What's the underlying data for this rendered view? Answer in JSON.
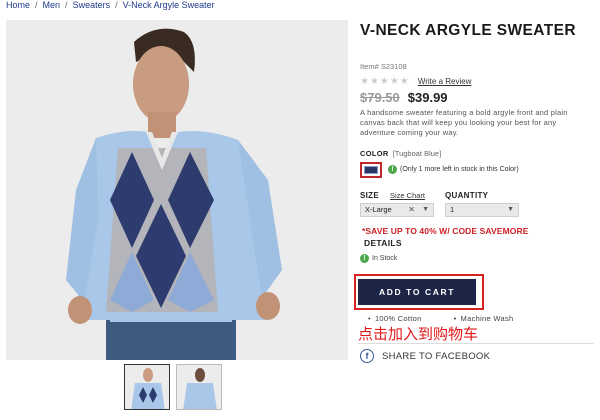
{
  "breadcrumb": [
    "Home",
    "Men",
    "Sweaters",
    "V-Neck Argyle Sweater"
  ],
  "breadcrumb_separator": "/",
  "product": {
    "title": "V-NECK ARGYLE SWEATER",
    "item_number": "Item# S23108",
    "rating_stars": 0,
    "rating_max": 5,
    "review_link": "Write a Review",
    "old_price": "$79.50",
    "new_price": "$39.99",
    "description": "A handsome sweater featuring a bold argyle front and plain canvas back that will keep you looking your best for any adventure coming your way."
  },
  "color": {
    "label": "COLOR",
    "value": "[Tugboat Blue]",
    "swatch_color": "#2a3766",
    "stock_note": "(Only 1 more left in stock in this Color)"
  },
  "size": {
    "label": "SIZE",
    "chart_link": "Size Chart",
    "selected": "X-Large"
  },
  "quantity": {
    "label": "QUANTITY",
    "selected": "1"
  },
  "promo": "*SAVE UP TO 40% W/ CODE SAVEMORE",
  "details_label": "DETAILS",
  "in_stock": "In Stock",
  "add_to_cart": "ADD TO CART",
  "features": [
    "100% Cotton",
    "Machine Wash"
  ],
  "annotation": "点击加入到购物车",
  "share_facebook": "SHARE TO FACEBOOK",
  "colors": {
    "accent_red": "#d01f26",
    "cart_button": "#1c2546",
    "sweater_light": "#a9c7e8",
    "sweater_navy": "#2e3b6e",
    "sweater_grey": "#b3b5ba"
  }
}
